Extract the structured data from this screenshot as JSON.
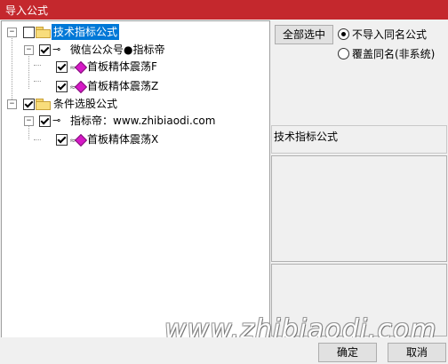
{
  "window": {
    "title": "导入公式"
  },
  "tree": {
    "nodes": [
      {
        "label": "技术指标公式",
        "checked": false,
        "selected": true,
        "expander": "−"
      },
      {
        "label": "微信公众号●指标帝",
        "checked": true,
        "expander": "−"
      },
      {
        "label": "首板精体震荡F",
        "checked": true
      },
      {
        "label": "首板精体震荡Z",
        "checked": true
      },
      {
        "label": "条件选股公式",
        "checked": true,
        "expander": "−"
      },
      {
        "label": "指标帝：www.zhibiaodi.com",
        "checked": true,
        "expander": "−"
      },
      {
        "label": "首板精体震荡X",
        "checked": true
      }
    ]
  },
  "options": {
    "select_all_label": "全部选中",
    "radio_no_import_label": "不导入同名公式",
    "radio_overwrite_label": "覆盖同名(非系统)",
    "selected_radio": "no_import"
  },
  "info": {
    "category_label": "技术指标公式"
  },
  "watermark": "www.zhibiaodi.com",
  "footer": {
    "ok_label": "确定",
    "cancel_label": "取消"
  }
}
